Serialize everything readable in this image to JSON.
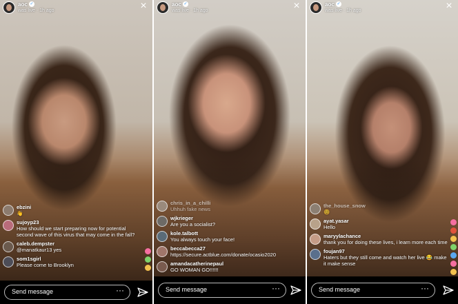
{
  "panels": [
    {
      "header": {
        "username": "aoc",
        "status": "was live · 1h ago"
      },
      "comments": [
        {
          "user": "ebzini",
          "text": "👋"
        },
        {
          "user": "sujoyp23",
          "text": "How should we start preparing now for potential second wave of this virus that may come in the fall?"
        },
        {
          "user": "caleb.dempster",
          "text": "@manatkaur13 yes"
        },
        {
          "user": "som1sgirl",
          "text": "Please come to Brooklyn"
        }
      ],
      "composer": {
        "placeholder": "Send message",
        "more": "···"
      }
    },
    {
      "header": {
        "username": "aoc",
        "status": "was live · 1h ago"
      },
      "comments": [
        {
          "user": "chris_in_a_chilli",
          "text": "Uhhuh fake news"
        },
        {
          "user": "wjkrieger",
          "text": "Are you a socialist?"
        },
        {
          "user": "kole.talbott",
          "text": "You always touch your face!"
        },
        {
          "user": "beccabecca27",
          "text": "https://secure.actblue.com/donate/ocasio2020"
        },
        {
          "user": "amandacatherinepaul",
          "text": "GO WOMAN GO!!!!!!"
        }
      ],
      "composer": {
        "placeholder": "Send message",
        "more": "···"
      }
    },
    {
      "header": {
        "username": "aoc",
        "status": "was live · 1h ago"
      },
      "comments": [
        {
          "user": "the_house_snow",
          "text": "😌"
        },
        {
          "user": "ayat.yasar",
          "text": "Hello"
        },
        {
          "user": "maryylachance",
          "text": "thank you for doing these lives, i learn more each time"
        },
        {
          "user": "foujan97",
          "text": "Haters but they still come and watch her live 😂 make it make sense"
        }
      ],
      "composer": {
        "placeholder": "Send message",
        "more": "···"
      }
    }
  ],
  "colors": {
    "verified": "#3897f0",
    "composer_bg": "#000000",
    "hearts": [
      "#f56fa1",
      "#7fd36b",
      "#f2c14e",
      "#5aa7f0",
      "#e0533c"
    ]
  }
}
